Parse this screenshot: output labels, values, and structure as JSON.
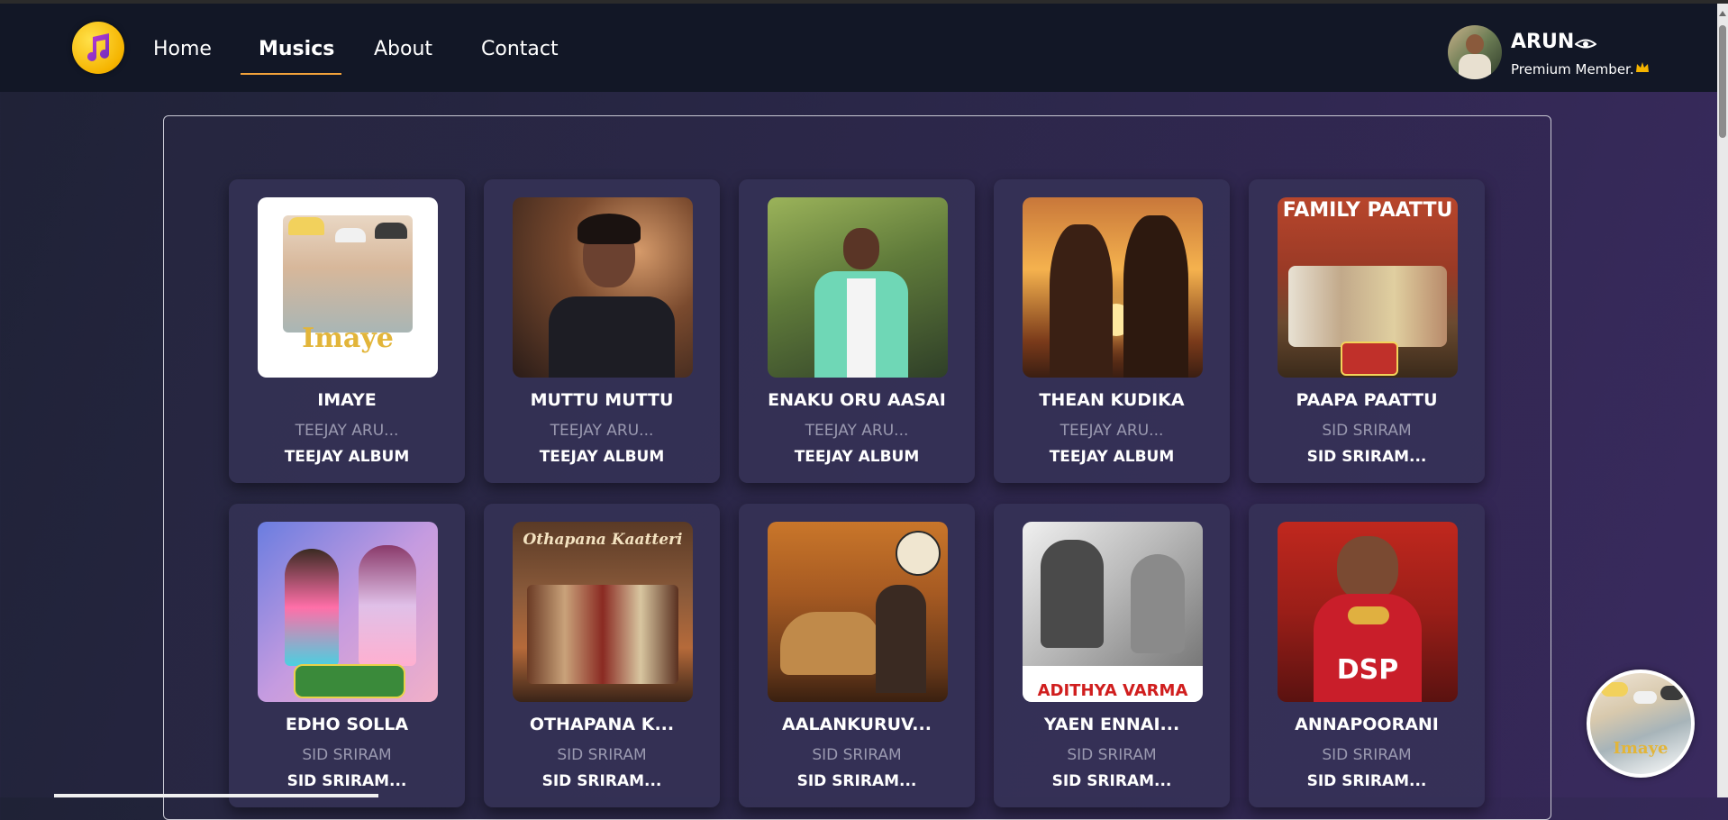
{
  "nav": {
    "links": [
      "Home",
      "Musics",
      "About",
      "Contact"
    ],
    "active": "Musics"
  },
  "user": {
    "name": "ARUN",
    "status": "Premium Member."
  },
  "colors": {
    "accent": "#f2a23a",
    "navbar": "#121726",
    "artist_text": "#9a99b0"
  },
  "songs": [
    {
      "title": "IMAYE",
      "artist": "TEEJAY ARU...",
      "album": "TEEJAY ALBUM",
      "cover_text": "Imaye"
    },
    {
      "title": "MUTTU MUTTU",
      "artist": "TEEJAY ARU...",
      "album": "TEEJAY ALBUM",
      "cover_text": ""
    },
    {
      "title": "ENAKU ORU AASAI",
      "artist": "TEEJAY ARU...",
      "album": "TEEJAY ALBUM",
      "cover_text": ""
    },
    {
      "title": "THEAN KUDIKA",
      "artist": "TEEJAY ARU...",
      "album": "TEEJAY ALBUM",
      "cover_text": ""
    },
    {
      "title": "PAAPA PAATTU",
      "artist": "SID SRIRAM",
      "album": "SID SRIRAM...",
      "cover_text": "FAMILY PAATTU"
    },
    {
      "title": "EDHO SOLLA",
      "artist": "SID SRIRAM",
      "album": "SID SRIRAM...",
      "cover_text": ""
    },
    {
      "title": "OTHAPANA K...",
      "artist": "SID SRIRAM",
      "album": "SID SRIRAM...",
      "cover_text": "Othapana Kaatteri"
    },
    {
      "title": "AALANKURUV...",
      "artist": "SID SRIRAM",
      "album": "SID SRIRAM...",
      "cover_text": ""
    },
    {
      "title": "YAEN ENNAI...",
      "artist": "SID SRIRAM",
      "album": "SID SRIRAM...",
      "cover_text": "ADITHYA VARMA"
    },
    {
      "title": "ANNAPOORANI",
      "artist": "SID SRIRAM",
      "album": "SID SRIRAM...",
      "cover_text": "DSP"
    }
  ],
  "mini_player": {
    "cover_text": "Imaye"
  }
}
